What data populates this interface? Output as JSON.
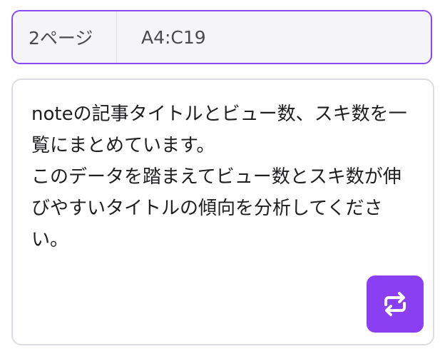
{
  "range_selector": {
    "page": "2ページ",
    "range": "A4:C19"
  },
  "prompt": {
    "text": "noteの記事タイトルとビュー数、スキ数を一覧にまとめています。\nこのデータを踏まえてビュー数とスキ数が伸びやすいタイトルの傾向を分析してください。"
  },
  "refresh_button": {
    "icon": "refresh-icon",
    "color": "#8b3ff2"
  },
  "colors": {
    "accent": "#8b47f5",
    "range_bar_bg": "#f5f4f7",
    "text": "#1e1e20"
  }
}
